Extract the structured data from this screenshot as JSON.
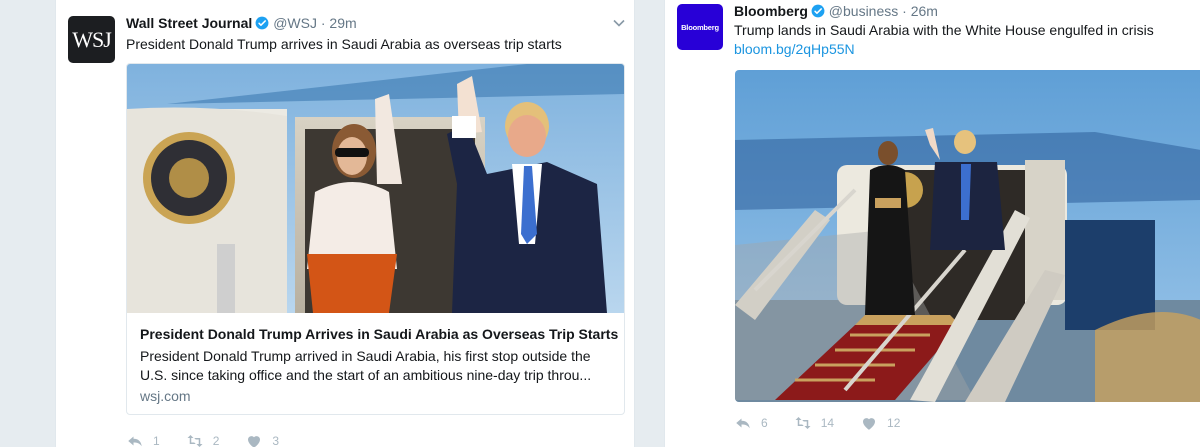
{
  "colors": {
    "brand_blue": "#1da1f2",
    "link": "#1b95e0",
    "muted": "#657786",
    "icon_muted": "#aab8c2",
    "bloomberg_bg": "#2800d7",
    "wsj_bg": "#1c1e21"
  },
  "tweet_left": {
    "avatar_text": "WSJ",
    "name": "Wall Street Journal",
    "handle": "@WSJ",
    "dot": "·",
    "time": "29m",
    "text": "President Donald Trump arrives in Saudi Arabia as overseas trip starts",
    "card": {
      "title": "President Donald Trump Arrives in Saudi Arabia as Overseas Trip Starts",
      "description": "President Donald Trump arrived in Saudi Arabia, his first stop outside the U.S. since taking office and the start of an ambitious nine-day trip throu...",
      "domain": "wsj.com"
    },
    "actions": {
      "reply": "1",
      "retweet": "2",
      "like": "3"
    }
  },
  "tweet_right": {
    "avatar_text": "Bloomberg",
    "name": "Bloomberg",
    "handle": "@business",
    "dot": "·",
    "time": "26m",
    "text": "Trump lands in Saudi Arabia with the White House engulfed in crisis",
    "link": "bloom.bg/2qHp55N",
    "actions": {
      "reply": "6",
      "retweet": "14",
      "like": "12"
    }
  }
}
